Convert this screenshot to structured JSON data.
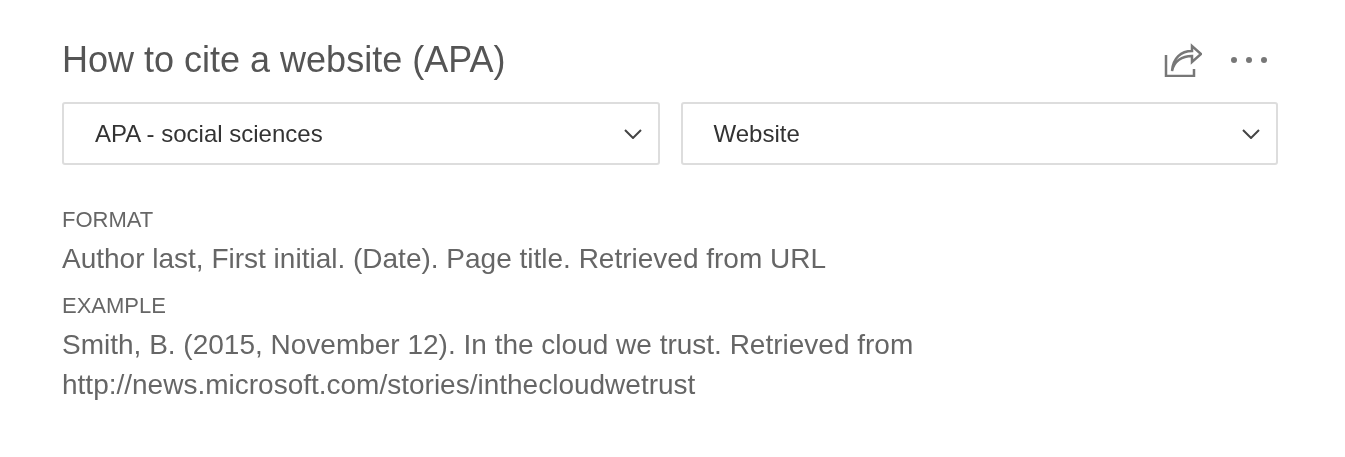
{
  "title": "How to cite a website (APA)",
  "dropdowns": [
    {
      "value": "APA - social sciences"
    },
    {
      "value": "Website"
    }
  ],
  "sections": [
    {
      "label": "FORMAT",
      "text": "Author last, First initial. (Date). Page title. Retrieved from URL"
    },
    {
      "label": "EXAMPLE",
      "text": "Smith, B. (2015, November 12). In the cloud we trust. Retrieved from http://news.microsoft.com/stories/inthecloudwetrust"
    }
  ]
}
